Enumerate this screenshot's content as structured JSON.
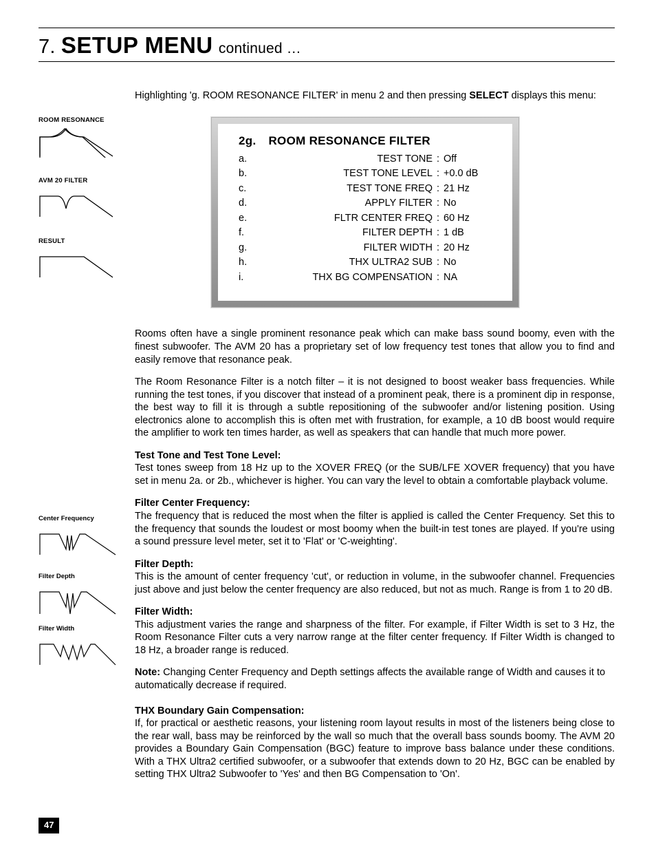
{
  "section": {
    "number": "7.",
    "title": "SETUP MENU",
    "continued": "continued …"
  },
  "intro": {
    "pre": "Highlighting 'g. ROOM RESONANCE FILTER' in menu 2 and then pressing ",
    "select": "SELECT",
    "post": " displays this menu:"
  },
  "left_minis": {
    "a": "ROOM RESONANCE",
    "b": "AVM 20 FILTER",
    "c": "RESULT"
  },
  "panel": {
    "num": "2g.",
    "title": "ROOM RESONANCE FILTER",
    "rows": [
      {
        "k": "a.",
        "lbl": "TEST TONE",
        "val": "Off"
      },
      {
        "k": "b.",
        "lbl": "TEST TONE LEVEL",
        "val": "+0.0 dB"
      },
      {
        "k": "c.",
        "lbl": "TEST TONE FREQ",
        "val": "21 Hz"
      },
      {
        "k": "d.",
        "lbl": "APPLY FILTER",
        "val": "No"
      },
      {
        "k": "e.",
        "lbl": "FLTR CENTER FREQ",
        "val": "60 Hz"
      },
      {
        "k": "f.",
        "lbl": "FILTER DEPTH",
        "val": "1 dB"
      },
      {
        "k": "g.",
        "lbl": "FILTER WIDTH",
        "val": "20 Hz"
      },
      {
        "k": "h.",
        "lbl": "THX ULTRA2 SUB",
        "val": "No"
      },
      {
        "k": "i.",
        "lbl": "THX BG COMPENSATION",
        "val": "NA"
      }
    ]
  },
  "body": {
    "p1": "Rooms often have a single prominent resonance peak which can make bass sound boomy, even with the finest subwoofer. The AVM 20 has a proprietary set of low frequency test tones that allow you to find and easily remove that resonance peak.",
    "p2": "The Room Resonance Filter is a notch filter – it is not designed to boost weaker bass frequencies. While running the test tones, if you discover that instead of a prominent peak, there is a prominent dip in response, the best way to fill it is through a subtle repositioning of the subwoofer and/or listening position. Using electronics alone to accomplish this is often met with frustration, for example, a 10 dB boost would require the amplifier to work ten times harder, as well as speakers that can handle that much more power.",
    "h_tt": "Test Tone and Test Tone Level:",
    "p_tt": "Test tones sweep from 18 Hz up to the XOVER FREQ (or the SUB/LFE XOVER frequency) that you have set in menu 2a. or 2b., whichever is higher. You can vary the level to obtain a comfortable playback volume.",
    "h_cf": "Filter Center Frequency:",
    "p_cf": "The frequency that is reduced the most when the filter is applied is called the Center Frequency. Set this to the frequency that sounds the loudest or most boomy when the built-in test tones are played. If you're using a sound pressure level meter, set it to 'Flat' or 'C-weighting'.",
    "h_fd": "Filter Depth:",
    "p_fd": "This is the amount of center frequency 'cut', or reduction in volume, in the subwoofer channel. Frequencies just above and just below the center frequency are also reduced, but not as much. Range is from 1 to 20 dB.",
    "h_fw": "Filter Width:",
    "p_fw": "This adjustment varies the range and sharpness of the filter. For example, if Filter Width is set to 3 Hz, the Room Resonance Filter cuts a very narrow range at the filter center frequency. If Filter Width is changed to 18 Hz, a broader range is reduced.",
    "note_label": "Note:",
    "note": " Changing Center Frequency and Depth settings affects the available range of Width and causes it to automatically decrease if required.",
    "h_thx": "THX Boundary Gain Compensation:",
    "p_thx": "If, for practical or aesthetic reasons, your listening room layout results in most of the listeners being close to the rear wall, bass may be reinforced by the wall so much that the overall bass sounds boomy. The AVM 20 provides a Boundary Gain Compensation (BGC) feature to improve bass balance under these conditions. With a THX Ultra2 certified subwoofer, or a subwoofer that extends down to 20 Hz, BGC can be enabled by setting THX Ultra2 Subwoofer to 'Yes' and then BG Compensation to 'On'."
  },
  "side": {
    "cf": "Center Frequency",
    "fd": "Filter Depth",
    "fw": "Filter Width"
  },
  "page_number": "47"
}
